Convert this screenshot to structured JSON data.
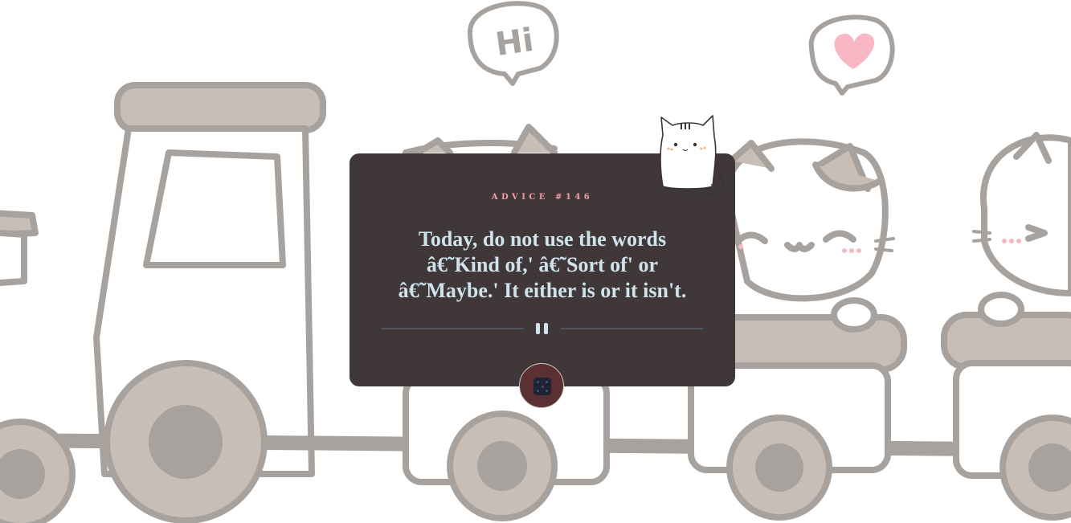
{
  "card": {
    "advice_id": "ADVICE #146",
    "advice_text": "Today, do not use the words â€˜Kind of,' â€˜Sort of' or â€˜Maybe.' It either is or it isn't."
  },
  "icons": {
    "divider": "pause-icon",
    "button": "dice-icon"
  },
  "illustration": {
    "speech_left": "Hi"
  },
  "colors": {
    "card_bg": "#403838",
    "accent_pink": "#f49bb0",
    "text": "#cfe3ec",
    "button_bg": "#5a3032"
  }
}
